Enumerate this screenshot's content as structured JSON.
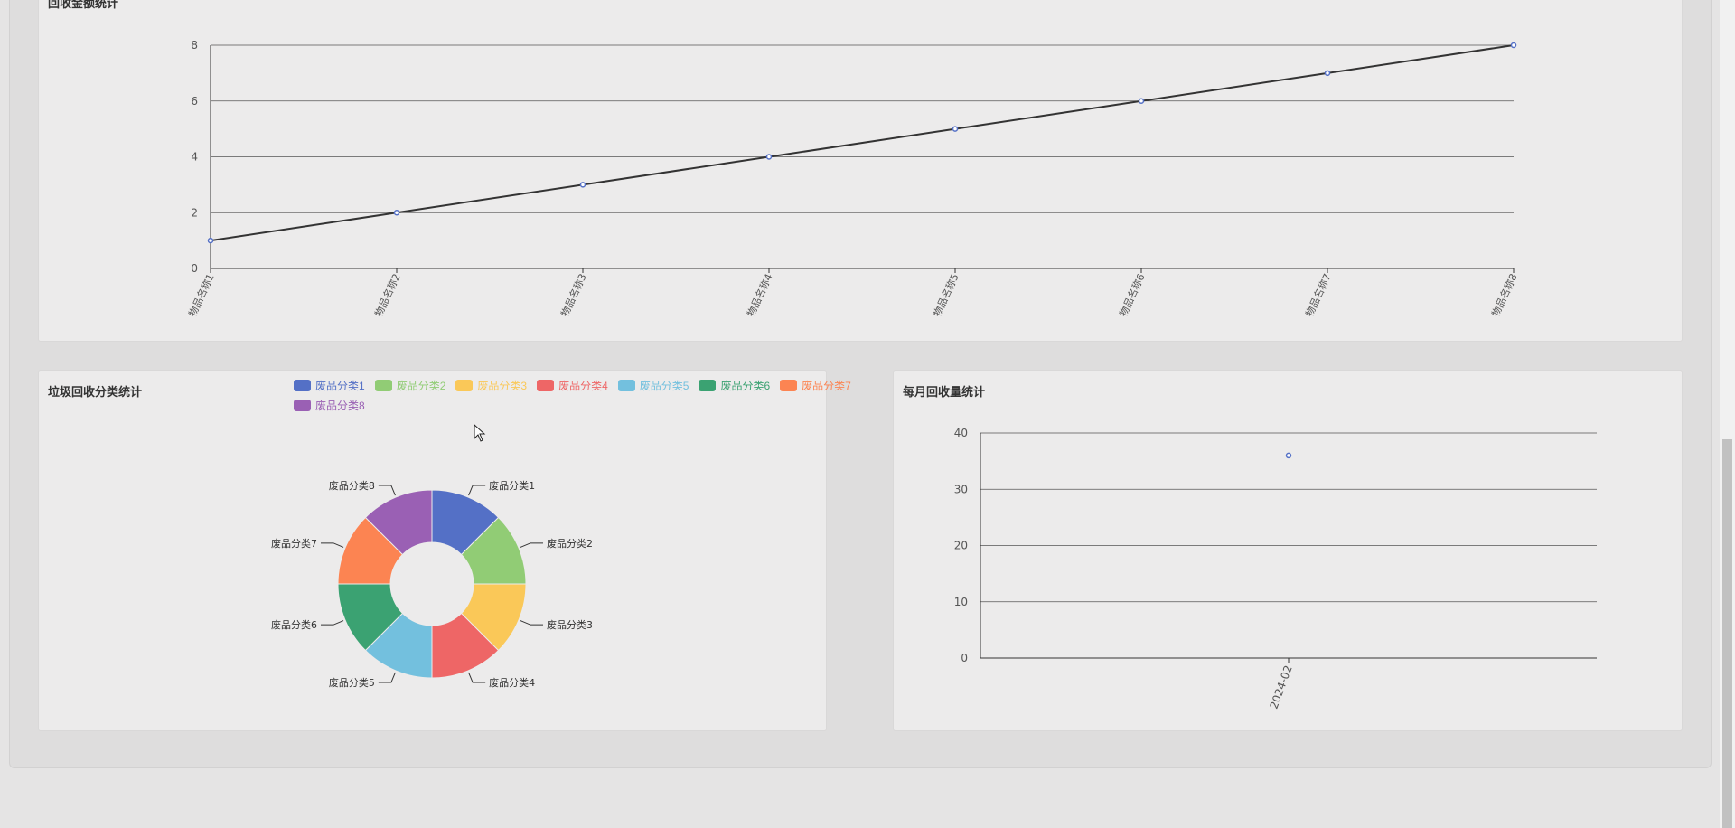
{
  "cards": {
    "amount": {
      "title": "回收金额统计",
      "chart_data": {
        "type": "line",
        "categories": [
          "物品名称1",
          "物品名称2",
          "物品名称3",
          "物品名称4",
          "物品名称5",
          "物品名称6",
          "物品名称7",
          "物品名称8"
        ],
        "values": [
          1,
          2,
          3,
          4,
          5,
          6,
          7,
          8
        ],
        "yticks": [
          0,
          2,
          4,
          6,
          8
        ],
        "ylim": [
          0,
          8
        ],
        "line_color": "#333333",
        "point_color": "#5470c6",
        "grid": true
      }
    },
    "category": {
      "title": "垃圾回收分类统计",
      "chart_data": {
        "type": "pie",
        "donut": true,
        "legend_position": "top",
        "categories": [
          "废品分类1",
          "废品分类2",
          "废品分类3",
          "废品分类4",
          "废品分类5",
          "废品分类6",
          "废品分类7",
          "废品分类8"
        ],
        "values": [
          1,
          1,
          1,
          1,
          1,
          1,
          1,
          1
        ],
        "colors": [
          "#5470c6",
          "#91cc75",
          "#fac858",
          "#ee6666",
          "#73c0de",
          "#3ba272",
          "#fc8452",
          "#9a60b4"
        ]
      }
    },
    "monthly": {
      "title": "每月回收量统计",
      "chart_data": {
        "type": "scatter",
        "categories": [
          "2024-02"
        ],
        "values": [
          36
        ],
        "yticks": [
          0,
          10,
          20,
          30,
          40
        ],
        "ylim": [
          0,
          40
        ],
        "point_color": "#5470c6",
        "grid": true
      }
    }
  }
}
